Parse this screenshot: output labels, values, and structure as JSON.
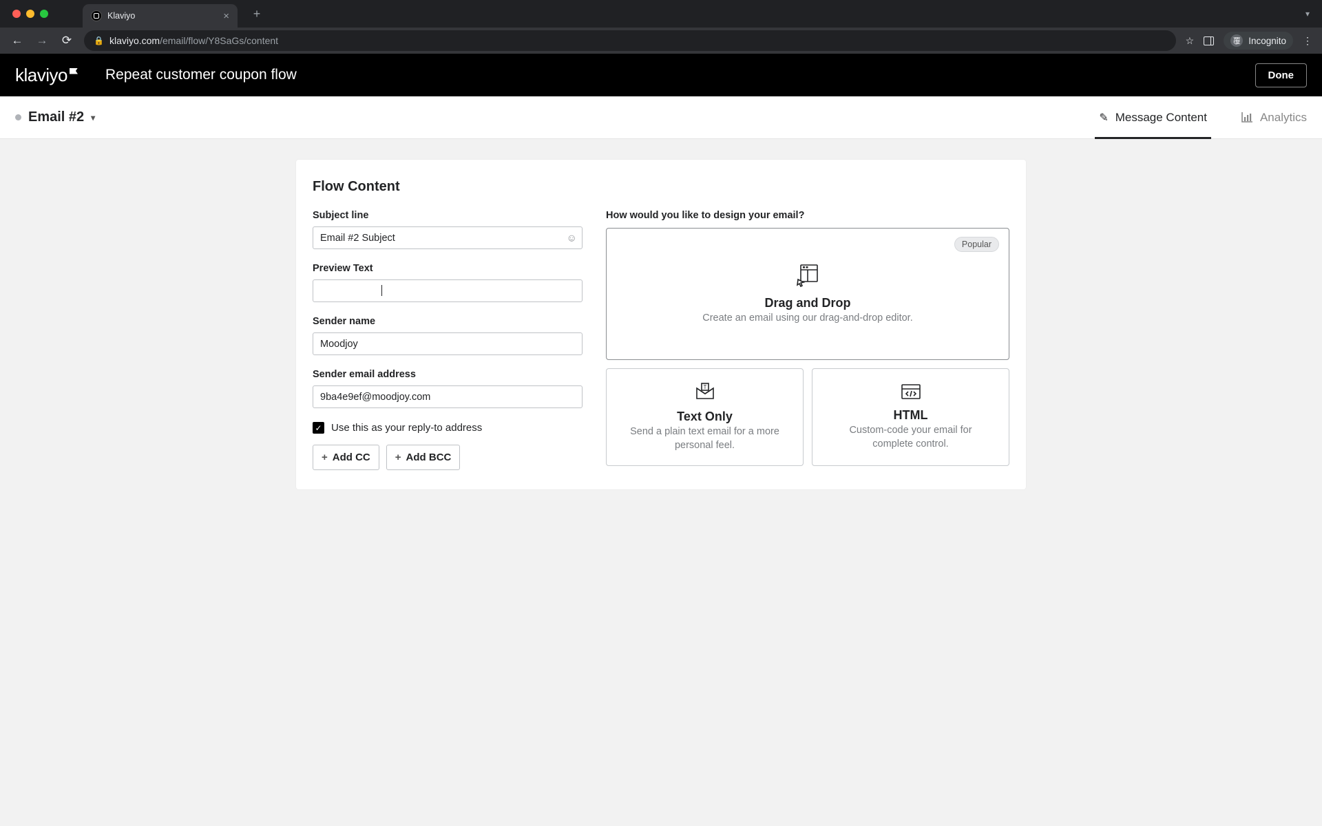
{
  "browser": {
    "tab_title": "Klaviyo",
    "url_domain": "klaviyo.com",
    "url_path": "/email/flow/Y8SaGs/content",
    "incognito_label": "Incognito"
  },
  "header": {
    "logo_text": "klaviyo",
    "page_title": "Repeat customer coupon flow",
    "done_label": "Done"
  },
  "subheader": {
    "breadcrumb": "Email #2",
    "tabs": {
      "message": "Message Content",
      "analytics": "Analytics"
    }
  },
  "panel": {
    "title": "Flow Content",
    "left": {
      "subject_label": "Subject line",
      "subject_value": "Email #2 Subject",
      "preview_label": "Preview Text",
      "preview_value": "",
      "sender_name_label": "Sender name",
      "sender_name_value": "Moodjoy",
      "sender_email_label": "Sender email address",
      "sender_email_value": "9ba4e9ef@moodjoy.com",
      "reply_to_label": "Use this as your reply-to address",
      "add_cc_label": "Add CC",
      "add_bcc_label": "Add BCC"
    },
    "right": {
      "heading": "How would you like to design your email?",
      "popular_badge": "Popular",
      "drag": {
        "title": "Drag and Drop",
        "desc": "Create an email using our drag-and-drop editor."
      },
      "text": {
        "title": "Text Only",
        "desc": "Send a plain text email for a more personal feel."
      },
      "html": {
        "title": "HTML",
        "desc": "Custom-code your email for complete control."
      }
    }
  }
}
